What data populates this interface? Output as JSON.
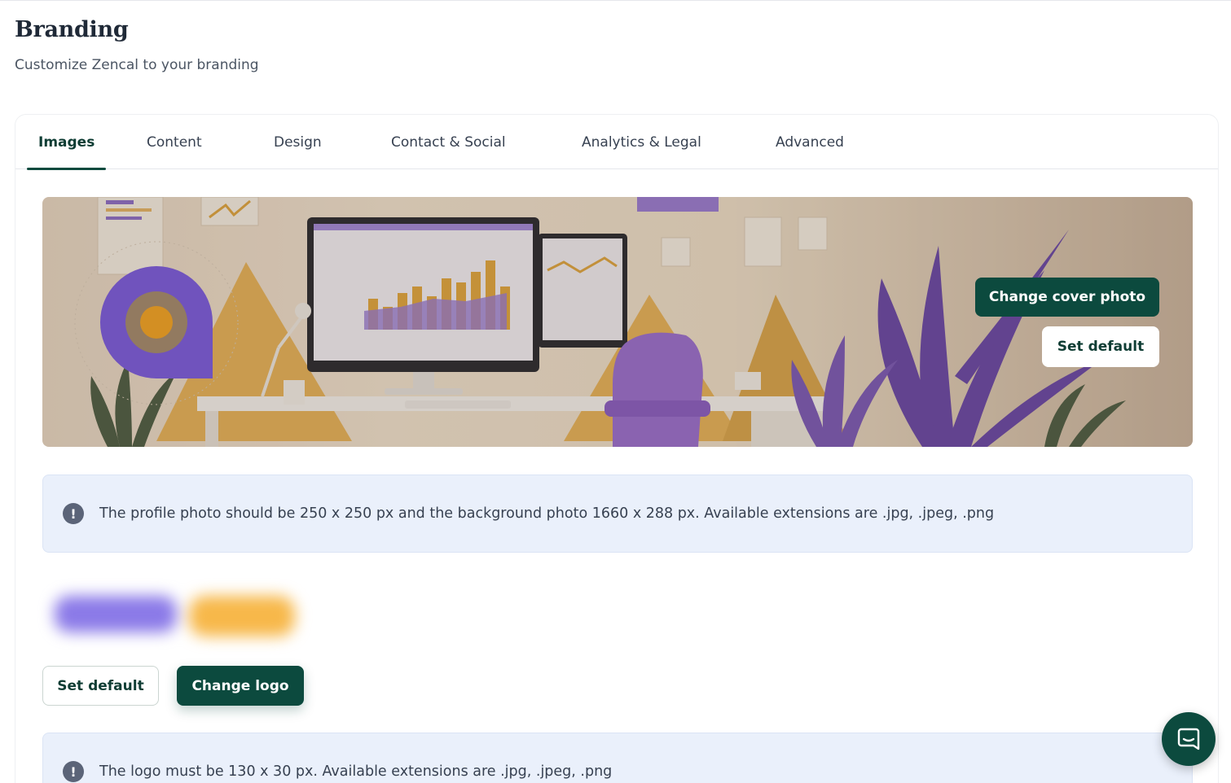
{
  "header": {
    "title": "Branding",
    "subtitle": "Customize Zencal to your branding"
  },
  "tabs": [
    {
      "label": "Images",
      "active": true
    },
    {
      "label": "Content",
      "active": false
    },
    {
      "label": "Design",
      "active": false
    },
    {
      "label": "Contact & Social",
      "active": false
    },
    {
      "label": "Analytics & Legal",
      "active": false
    },
    {
      "label": "Advanced",
      "active": false
    }
  ],
  "cover": {
    "change_label": "Change cover photo",
    "default_label": "Set default"
  },
  "profile_info": {
    "text": "The profile photo should be 250 x 250 px and the background photo 1660 x 288 px. Available extensions are .jpg, .jpeg, .png"
  },
  "logo": {
    "default_label": "Set default",
    "change_label": "Change logo"
  },
  "logo_info": {
    "text": "The logo must be 130 x 30 px. Available extensions are .jpg, .jpeg, .png"
  },
  "icons": {
    "info": "!",
    "chat": "chat-bubble-icon"
  },
  "colors": {
    "primary": "#0c4a3e",
    "info_bg": "#eaf0fb",
    "brand_purple": "#7c5ce0",
    "brand_orange": "#f5a524"
  }
}
